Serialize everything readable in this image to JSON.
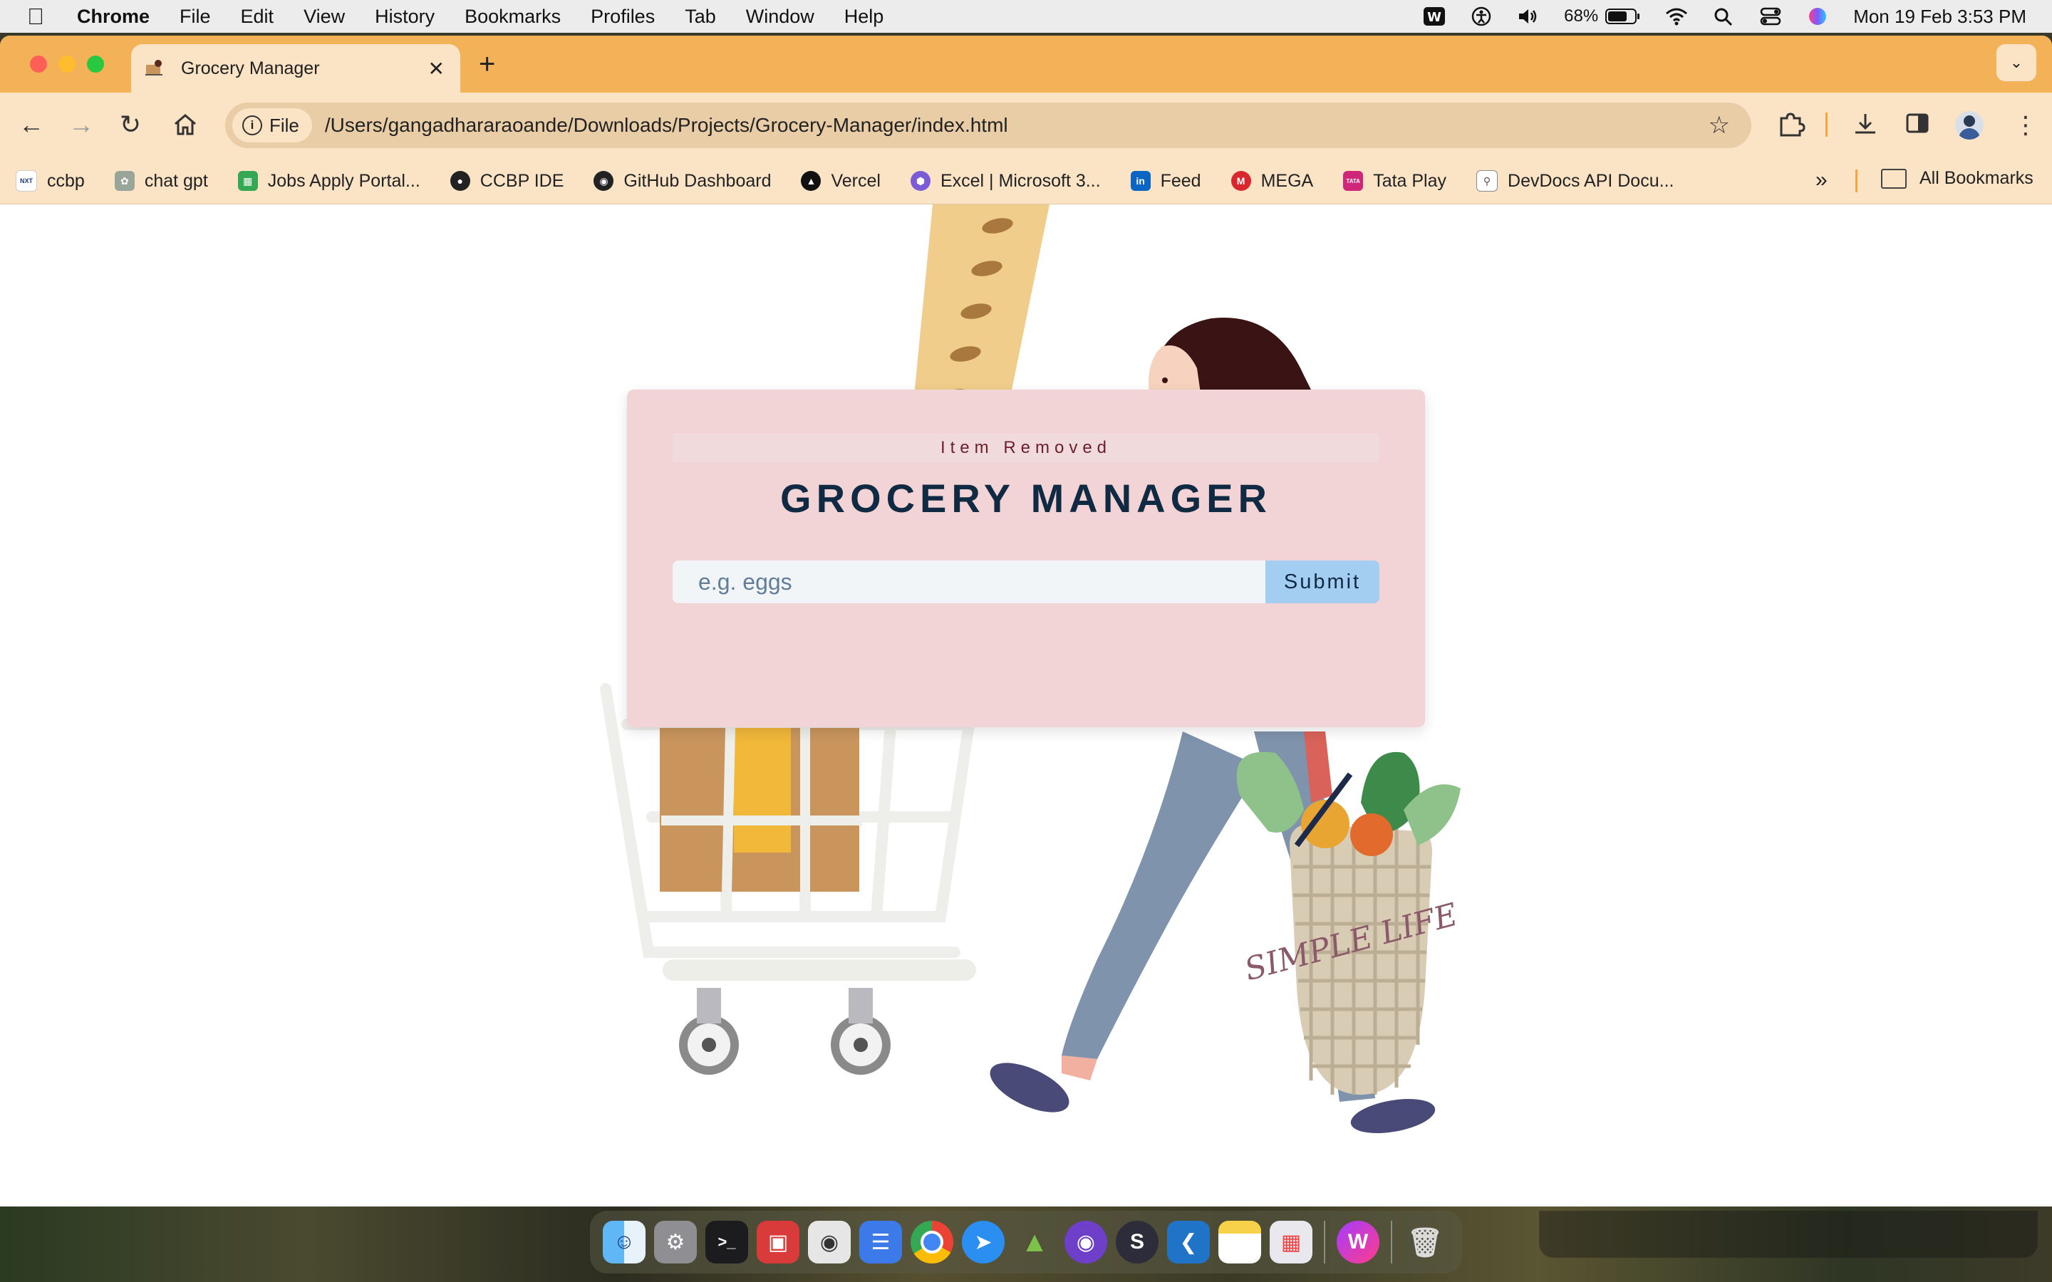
{
  "menubar": {
    "app": "Chrome",
    "menus": [
      "File",
      "Edit",
      "View",
      "History",
      "Bookmarks",
      "Profiles",
      "Tab",
      "Window",
      "Help"
    ],
    "battery": "68%",
    "datetime": "Mon 19 Feb  3:53 PM"
  },
  "browser": {
    "tab_title": "Grocery Manager",
    "new_tab": "+",
    "chip_label": "File",
    "url": "/Users/gangadhararaoande/Downloads/Projects/Grocery-Manager/index.html"
  },
  "bookmarks": [
    {
      "label": "ccbp",
      "color": "#1d3c78"
    },
    {
      "label": "chat gpt",
      "color": "#9aa59a"
    },
    {
      "label": "Jobs Apply Portal...",
      "color": "#34a853"
    },
    {
      "label": "CCBP IDE",
      "color": "#222222"
    },
    {
      "label": "GitHub Dashboard",
      "color": "#222222"
    },
    {
      "label": "Vercel",
      "color": "#111111"
    },
    {
      "label": "Excel | Microsoft 3...",
      "color": "#7b5cd6"
    },
    {
      "label": "Feed",
      "color": "#0a66c2"
    },
    {
      "label": "MEGA",
      "color": "#d9272e"
    },
    {
      "label": "Tata Play",
      "color": "#d0267a"
    },
    {
      "label": "DevDocs API Docu...",
      "color": "#8a8a8a"
    }
  ],
  "bookmarks_all": "All Bookmarks",
  "app": {
    "alert": "Item Removed",
    "title": "GROCERY MANAGER",
    "input_placeholder": "e.g. eggs",
    "submit_label": "Submit",
    "basket_text": "SIMPLE LIFE"
  },
  "colors": {
    "tabstrip": "#f3b158",
    "toolbar": "#fbe3c5",
    "card": "#f2d3d6",
    "heading": "#102a43",
    "submit": "#a4cdf2"
  }
}
